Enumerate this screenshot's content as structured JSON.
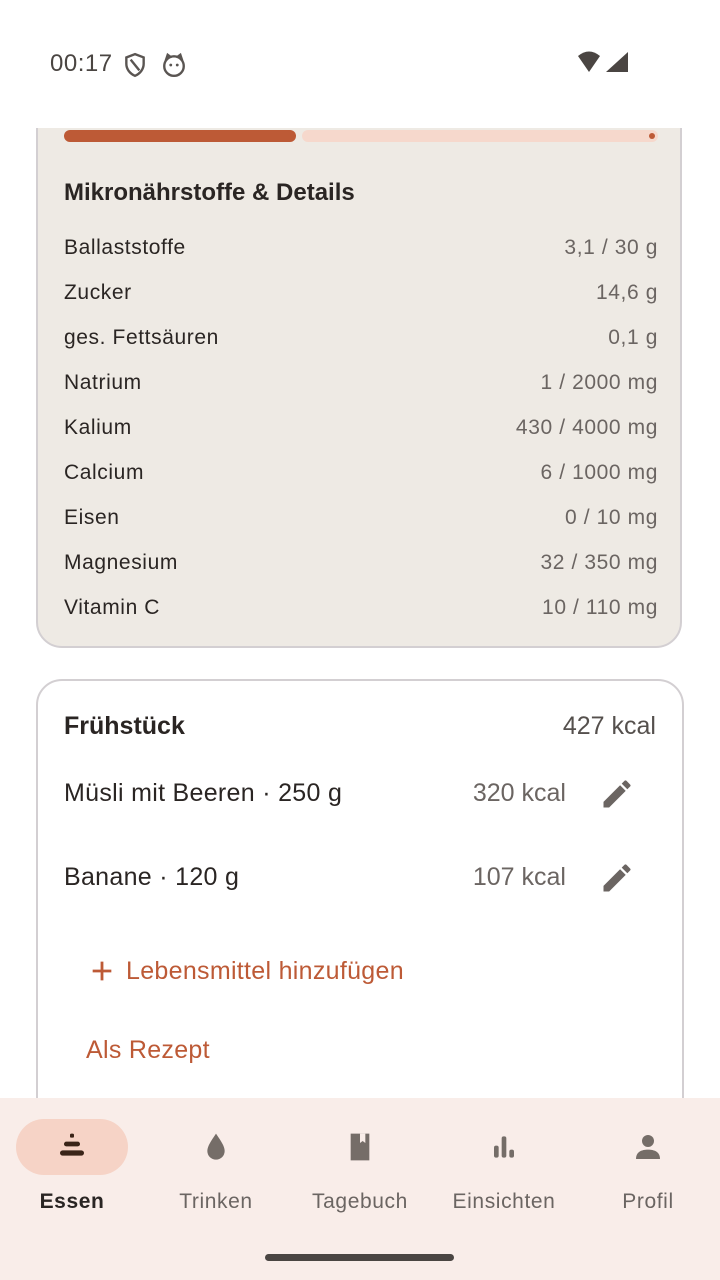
{
  "status": {
    "time": "00:17"
  },
  "progress": {
    "fraction": 0.39
  },
  "micro": {
    "title": "Mikronährstoffe & Details",
    "rows": [
      {
        "label": "Ballaststoffe",
        "value": "3,1 / 30 g"
      },
      {
        "label": "Zucker",
        "value": "14,6 g"
      },
      {
        "label": "ges. Fettsäuren",
        "value": "0,1 g"
      },
      {
        "label": "Natrium",
        "value": "1 / 2000 mg"
      },
      {
        "label": "Kalium",
        "value": "430 / 4000 mg"
      },
      {
        "label": "Calcium",
        "value": "6 / 1000 mg"
      },
      {
        "label": "Eisen",
        "value": "0 / 10 mg"
      },
      {
        "label": "Magnesium",
        "value": "32 / 350 mg"
      },
      {
        "label": "Vitamin C",
        "value": "10 / 110 mg"
      }
    ]
  },
  "meal": {
    "title": "Frühstück",
    "kcal": "427 kcal",
    "items": [
      {
        "name": "Müsli mit Beeren · 250 g",
        "kcal": "320 kcal",
        "icon": "pencil-icon"
      },
      {
        "name": "Banane · 120 g",
        "kcal": "107 kcal",
        "icon": "pencil-icon"
      }
    ],
    "add_label": "Lebensmittel hinzufügen",
    "recipe_label": "Als Rezept"
  },
  "nav": {
    "items": [
      {
        "label": "Essen",
        "icon": "food-stack-icon",
        "active": true
      },
      {
        "label": "Trinken",
        "icon": "water-drop-icon",
        "active": false
      },
      {
        "label": "Tagebuch",
        "icon": "book-icon",
        "active": false
      },
      {
        "label": "Einsichten",
        "icon": "bar-chart-icon",
        "active": false
      },
      {
        "label": "Profil",
        "icon": "person-icon",
        "active": false
      }
    ]
  },
  "colors": {
    "accent": "#bd5a36",
    "accent_light": "#f6d8cc",
    "card_bg": "#eeeae4",
    "nav_bg": "#f9ede9",
    "nav_active_pill": "#f6d3c6"
  }
}
